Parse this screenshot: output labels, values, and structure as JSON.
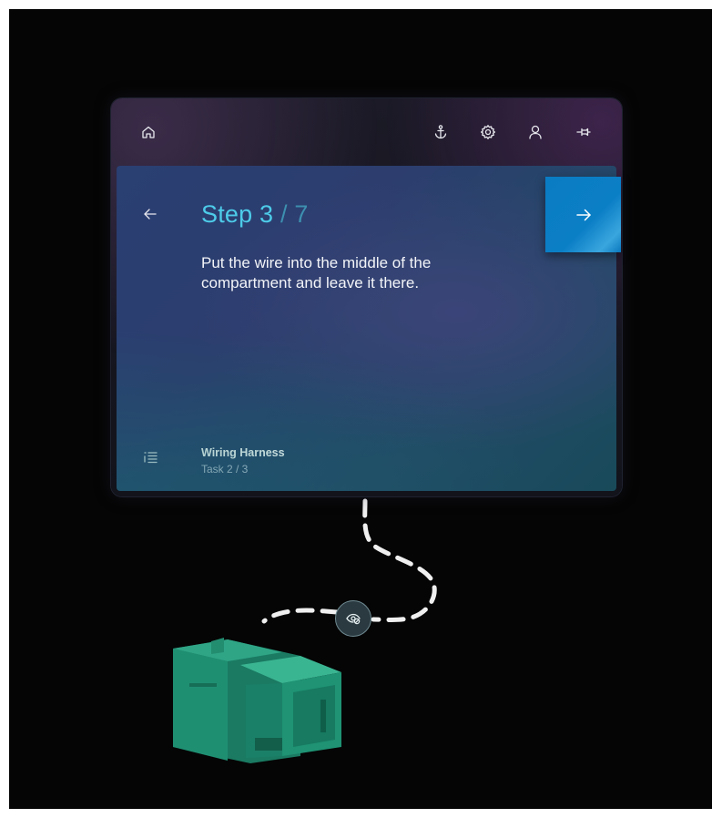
{
  "step": {
    "current": "Step 3",
    "total": " / 7",
    "instruction": "Put the wire into the middle of the compartment and leave it there."
  },
  "task": {
    "name": "Wiring Harness",
    "progress": "Task 2 / 3"
  },
  "icons": {
    "home": "home-icon",
    "anchor": "anchor-icon",
    "settings": "gear-icon",
    "user": "person-icon",
    "pin": "pin-icon",
    "back": "arrow-left-icon",
    "next": "arrow-right-icon",
    "list": "list-icon",
    "tether": "eye-hidden-icon"
  },
  "colors": {
    "accent": "#4dcbe8",
    "next_button": "#0b7fc6",
    "model": "#1f8f72"
  }
}
